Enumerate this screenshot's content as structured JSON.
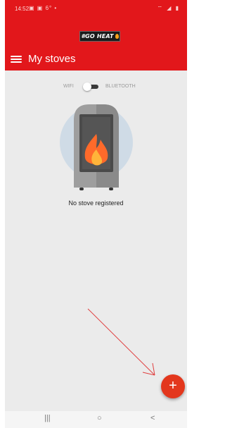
{
  "status_bar": {
    "time": "14:52",
    "notifications": "▣ ▣ 6° •",
    "system": "⌔ ◢ ▮"
  },
  "app_bar": {
    "logo_text": "#GO HEAT",
    "title": "My stoves"
  },
  "connection_toggle": {
    "left_label": "WIFI",
    "right_label": "BLUETOOTH",
    "selected": "WIFI"
  },
  "empty_state": {
    "message": "No stove registered"
  },
  "fab": {
    "label": "+"
  },
  "nav_bar": {
    "recents": "|||",
    "home": "○",
    "back": "<"
  },
  "colors": {
    "primary": "#e2171b",
    "fab": "#e3371d",
    "background": "#ebebeb",
    "annotation": "#e04040"
  },
  "icons": {
    "menu": "hamburger-icon",
    "stove": "stove-fire-icon",
    "fab": "plus-icon"
  }
}
